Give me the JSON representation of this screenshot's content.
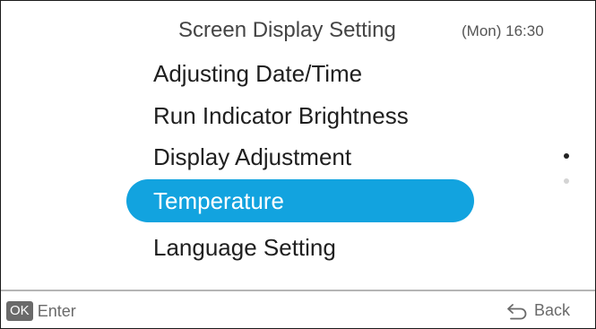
{
  "header": {
    "title": "Screen Display Setting",
    "clock": "(Mon) 16:30"
  },
  "menu": {
    "items": [
      {
        "label": "Adjusting Date/Time",
        "selected": false
      },
      {
        "label": "Run Indicator Brightness",
        "selected": false
      },
      {
        "label": "Display Adjustment",
        "selected": false
      },
      {
        "label": "Temperature",
        "selected": true
      },
      {
        "label": "Language Setting",
        "selected": false
      }
    ]
  },
  "pagination": {
    "pages": 2,
    "current_page": 1
  },
  "footer": {
    "ok_badge": "OK",
    "enter_label": "Enter",
    "back_label": "Back",
    "back_icon": "back-arrow-icon"
  },
  "colors": {
    "highlight": "#12a3df",
    "text": "#1f1f1f",
    "footer_text": "#6a6a6a"
  }
}
